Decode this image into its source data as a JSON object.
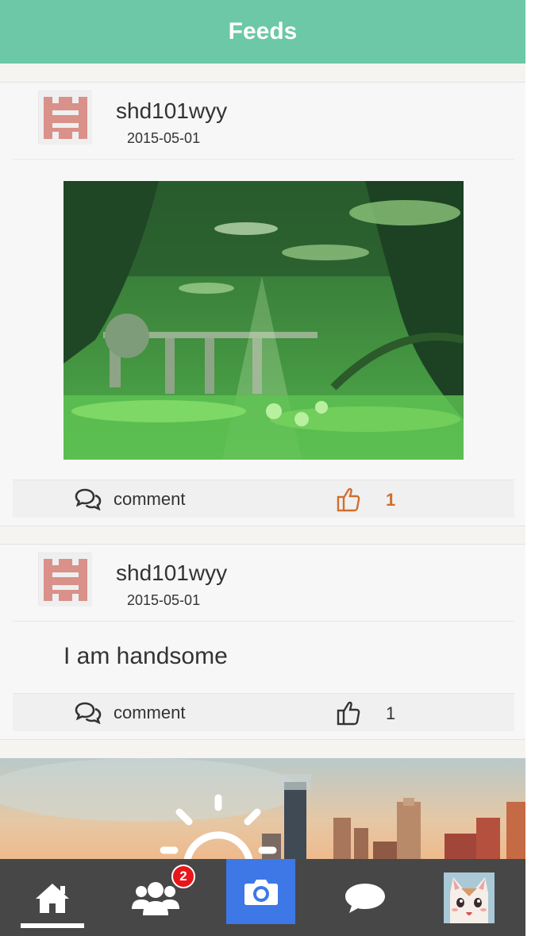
{
  "header": {
    "title": "Feeds"
  },
  "feed": {
    "posts": [
      {
        "username": "shd101wyy",
        "date": "2015-05-01",
        "type": "image",
        "comment_label": "comment",
        "like_count": "1",
        "liked": true
      },
      {
        "username": "shd101wyy",
        "date": "2015-05-01",
        "type": "text",
        "text": "I am handsome",
        "comment_label": "comment",
        "like_count": "1",
        "liked": false
      }
    ]
  },
  "tabbar": {
    "friends_badge": "2",
    "items": [
      "home-icon",
      "friends-icon",
      "camera-icon",
      "chat-bubble-icon",
      "profile-avatar"
    ]
  },
  "colors": {
    "header": "#6cc8a6",
    "liked": "#cf6f2e",
    "tabbar": "#474747",
    "camera": "#3e78e6",
    "badge": "#e8161b"
  }
}
